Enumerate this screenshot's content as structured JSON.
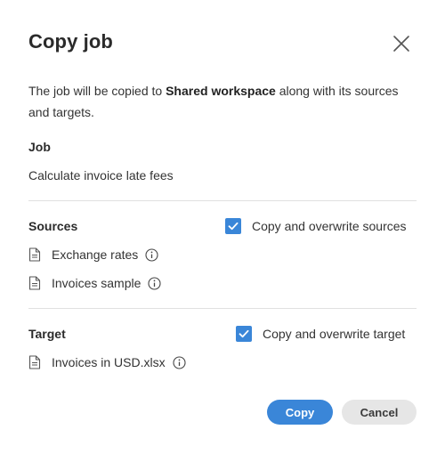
{
  "dialog": {
    "title": "Copy job",
    "description_prefix": "The job will be copied to ",
    "description_bold": "Shared workspace",
    "description_suffix": " along with its sources and targets."
  },
  "job": {
    "label": "Job",
    "name": "Calculate invoice late fees"
  },
  "sources": {
    "label": "Sources",
    "checkbox_label": "Copy and overwrite sources",
    "checked": true,
    "items": [
      "Exchange rates",
      "Invoices sample"
    ]
  },
  "target": {
    "label": "Target",
    "checkbox_label": "Copy and overwrite target",
    "checked": true,
    "items": [
      "Invoices in USD.xlsx"
    ]
  },
  "buttons": {
    "copy": "Copy",
    "cancel": "Cancel"
  },
  "colors": {
    "accent": "#3a86d8",
    "secondary_button": "#e6e6e6",
    "divider": "#e1e1e1"
  },
  "icons": {
    "close": "close-icon",
    "file": "file-icon",
    "info": "info-icon",
    "check": "check-icon"
  }
}
